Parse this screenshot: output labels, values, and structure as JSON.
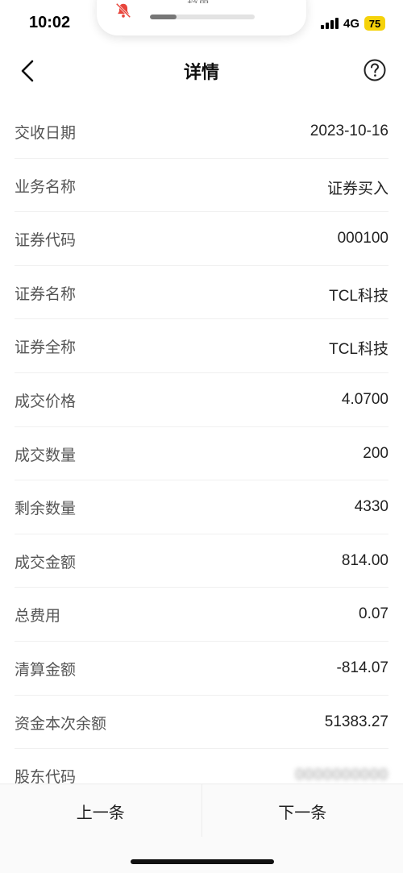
{
  "status_bar": {
    "time": "10:02",
    "network": "4G",
    "battery": "75",
    "battery_color": "#f5d20a"
  },
  "notification": {
    "label": "铃声",
    "icon": "bell-muted-icon",
    "icon_color": "#e8453c",
    "volume_level": 0.25
  },
  "header": {
    "title": "详情",
    "back_icon": "chevron-left-icon",
    "help_icon": "question-circle-icon"
  },
  "details": [
    {
      "label": "交收日期",
      "value": "2023-10-16"
    },
    {
      "label": "业务名称",
      "value": "证券买入"
    },
    {
      "label": "证券代码",
      "value": "000100"
    },
    {
      "label": "证券名称",
      "value": "TCL科技"
    },
    {
      "label": "证券全称",
      "value": "TCL科技"
    },
    {
      "label": "成交价格",
      "value": "4.0700"
    },
    {
      "label": "成交数量",
      "value": "200"
    },
    {
      "label": "剩余数量",
      "value": "4330"
    },
    {
      "label": "成交金额",
      "value": "814.00"
    },
    {
      "label": "总费用",
      "value": "0.07"
    },
    {
      "label": "清算金额",
      "value": "-814.07"
    },
    {
      "label": "资金本次余额",
      "value": "51383.27"
    },
    {
      "label": "股东代码",
      "value": "0000000000"
    }
  ],
  "toolbar": {
    "prev_label": "上一条",
    "next_label": "下一条"
  }
}
